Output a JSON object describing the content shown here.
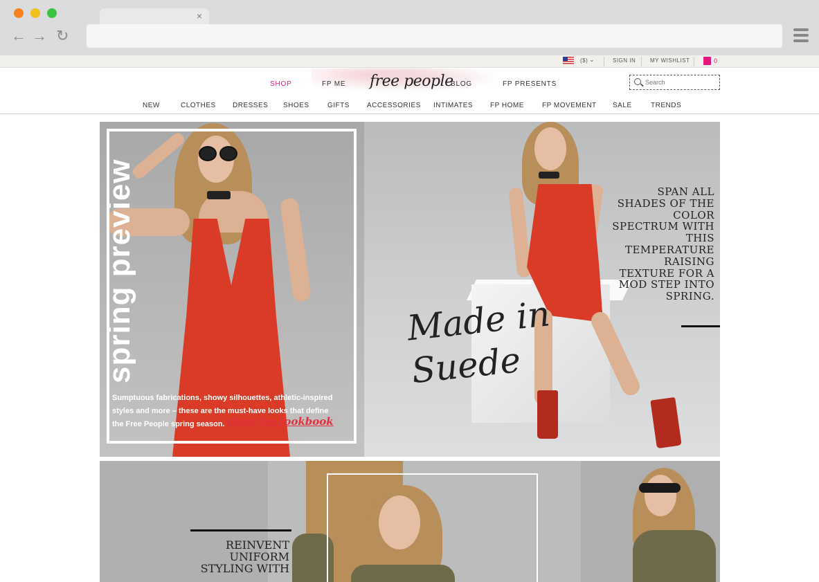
{
  "browser": {
    "tab_close": "×",
    "back": "←",
    "forward": "→",
    "reload": "↻"
  },
  "utility": {
    "currency": "($)",
    "sign_in": "SIGN IN",
    "wishlist": "MY WISHLIST",
    "bag_count": "0"
  },
  "header": {
    "logo": "free people",
    "top_nav": [
      "SHOP",
      "FP ME",
      "BLOG",
      "FP PRESENTS"
    ],
    "search_placeholder": "Search",
    "main_nav": [
      "NEW",
      "CLOTHES",
      "DRESSES",
      "SHOES",
      "GIFTS",
      "ACCESSORIES",
      "INTIMATES",
      "FP HOME",
      "FP MOVEMENT",
      "SALE",
      "TRENDS"
    ]
  },
  "hero": {
    "title": "spring preview",
    "copy": "Sumptuous fabrications, showy silhouettes, athletic-inspired styles and more – these are the must-have looks that define the Free People spring season.",
    "shop_link": "shop the lookbook",
    "right_text": "SPAN ALL SHADES OF THE COLOR SPECTRUM WITH THIS TEMPERATURE RAISING TEXTURE FOR A MOD STEP INTO SPRING.",
    "script": "Made in Suede"
  },
  "row2": {
    "text": "REINVENT UNIFORM STYLING WITH"
  },
  "colors": {
    "accent": "#e5177e",
    "dress": "#d93b26",
    "link": "#e22f3f"
  }
}
